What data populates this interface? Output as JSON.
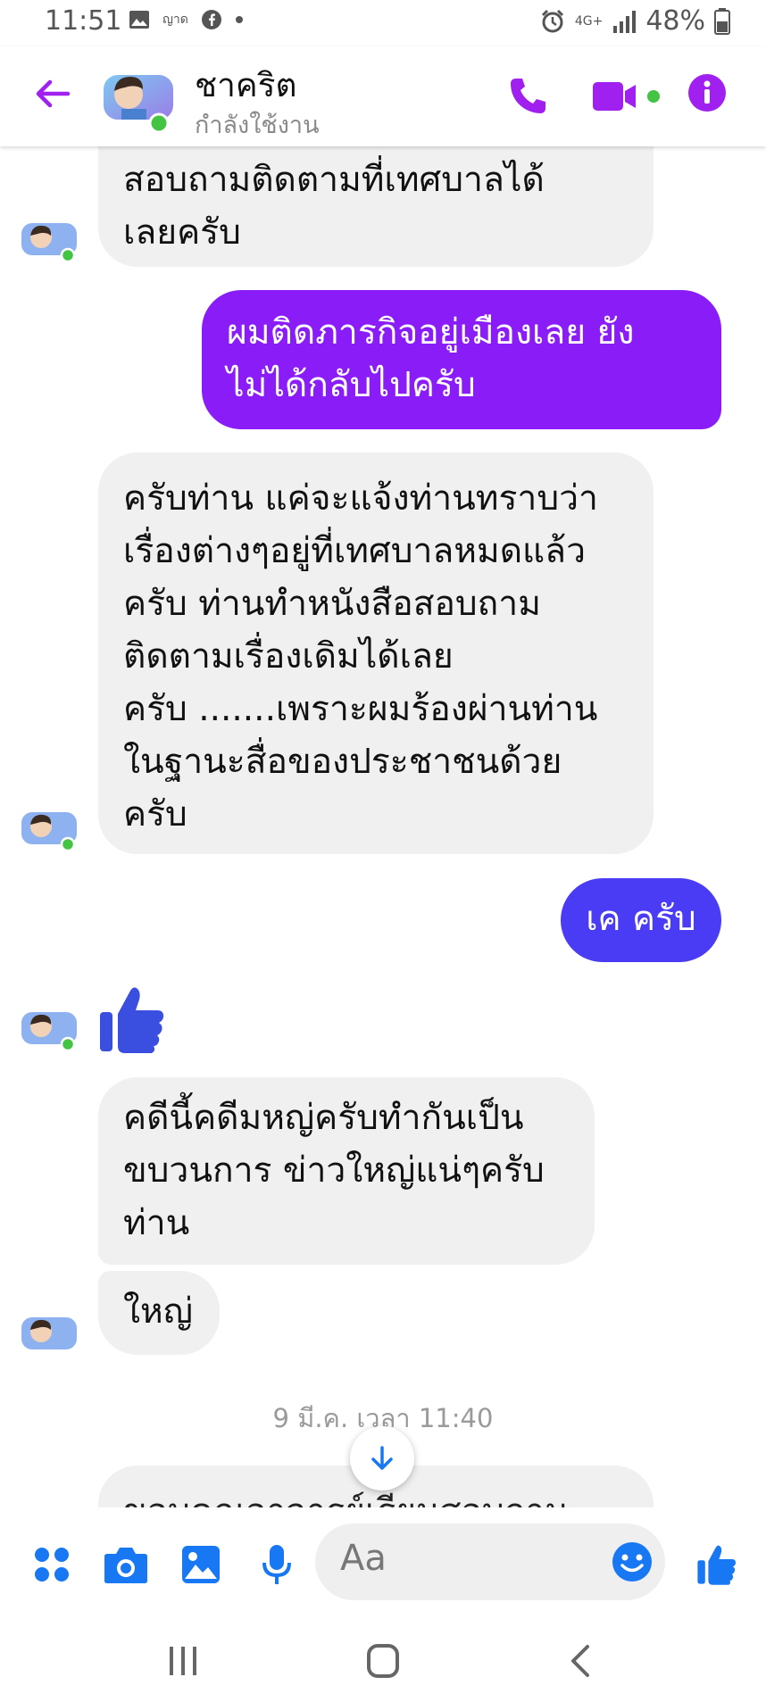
{
  "status_bar": {
    "time": "11:51",
    "carrier_small": "ญาด",
    "network": "4G+",
    "battery": "48%"
  },
  "header": {
    "contact_name": "ชาคริต",
    "status": "กำลังใช้งาน"
  },
  "messages": [
    {
      "id": "m1",
      "side": "in",
      "lines": [
        "สอบถามติดตามที่เทศบาลได้",
        "เลยครับ"
      ]
    },
    {
      "id": "m2",
      "side": "out",
      "lines": [
        "ผมติดภารกิจอยู่เมืองเลย ยัง",
        "ไม่ได้กลับไปครับ"
      ]
    },
    {
      "id": "m3",
      "side": "in",
      "lines": [
        "ครับท่าน แค่จะแจ้งท่านทราบว่า",
        "เรื่องต่างๆอยู่ที่เทศบาลหมดแล้ว",
        "ครับ ท่านทำหนังสือสอบถาม",
        "ติดตามเรื่องเดิมได้เลย",
        "ครับ  .......เพราะผมร้องผ่านท่าน",
        "ในฐานะสื่อของประชาชนด้วย",
        "ครับ"
      ]
    },
    {
      "id": "m4",
      "side": "out",
      "lines": [
        "เค ครับ"
      ]
    },
    {
      "id": "m6",
      "side": "in",
      "lines": [
        "คดีนี้คดีมหญ่ครับทำกันเป็น",
        "ขบวนการ  ข่าวใหญ่แน่ๆครับ",
        "ท่าน"
      ]
    },
    {
      "id": "m7",
      "side": "in",
      "lines": [
        "ใหญ่"
      ]
    },
    {
      "id": "m8",
      "side": "in",
      "lines": [
        "ขอบคุณอาจารย์เรียนสอบถามเรื่อง"
      ]
    }
  ],
  "timestamp": "9 มี.ค. เวลา 11:40",
  "composer": {
    "placeholder": "Aa"
  },
  "colors": {
    "accent": "#a020f0",
    "out_purple": "#8a1cf7",
    "out_blue": "#4a3cf5",
    "in_bubble": "#f0f0f0",
    "like": "#3a4fe0",
    "online": "#43c443"
  }
}
